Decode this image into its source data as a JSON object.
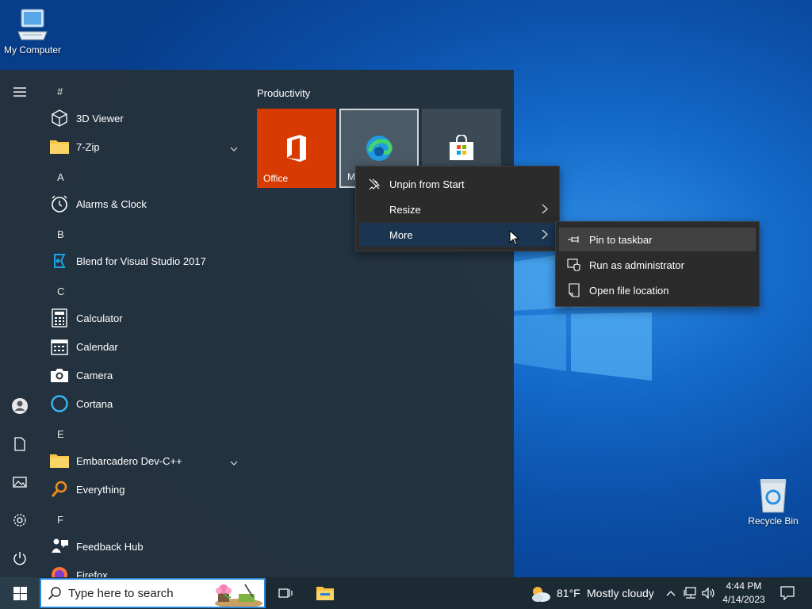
{
  "desktop": {
    "icons": [
      {
        "label": "My Computer",
        "icon": "computer-icon"
      },
      {
        "label": "Recycle Bin",
        "icon": "recycle-bin-icon"
      }
    ]
  },
  "start_menu": {
    "rail": [
      "hamburger-icon",
      "user-icon",
      "documents-icon",
      "pictures-icon",
      "settings-icon",
      "power-icon"
    ],
    "app_list": {
      "letters": [
        "#",
        "A",
        "B",
        "C",
        "E",
        "F"
      ],
      "apps": [
        {
          "label": "3D Viewer",
          "icon": "cube-icon"
        },
        {
          "label": "7-Zip",
          "icon": "folder-icon",
          "expandable": true
        },
        {
          "label": "Alarms & Clock",
          "icon": "clock-icon"
        },
        {
          "label": "Blend for Visual Studio 2017",
          "icon": "blend-icon"
        },
        {
          "label": "Calculator",
          "icon": "calculator-icon"
        },
        {
          "label": "Calendar",
          "icon": "calendar-icon"
        },
        {
          "label": "Camera",
          "icon": "camera-icon"
        },
        {
          "label": "Cortana",
          "icon": "cortana-icon"
        },
        {
          "label": "Embarcadero Dev-C++",
          "icon": "folder-icon",
          "expandable": true
        },
        {
          "label": "Everything",
          "icon": "search-magnifier-icon"
        },
        {
          "label": "Feedback Hub",
          "icon": "feedback-icon"
        },
        {
          "label": "Firefox",
          "icon": "firefox-icon"
        }
      ]
    },
    "tiles": {
      "group_title": "Productivity",
      "items": [
        {
          "label": "Office",
          "color": "#d83b01"
        },
        {
          "label": "M",
          "color": "#4a5a66"
        },
        {
          "label": "",
          "color": "#3c4a55"
        }
      ]
    }
  },
  "context_menu": {
    "items": [
      {
        "label": "Unpin from Start",
        "icon": "unpin-icon"
      },
      {
        "label": "Resize",
        "has_submenu": true
      },
      {
        "label": "More",
        "has_submenu": true,
        "active": true
      }
    ]
  },
  "submenu": {
    "items": [
      {
        "label": "Pin to taskbar",
        "icon": "pin-icon"
      },
      {
        "label": "Run as administrator",
        "icon": "shield-icon"
      },
      {
        "label": "Open file location",
        "icon": "file-location-icon"
      }
    ]
  },
  "taskbar": {
    "search_placeholder": "Type here to search",
    "weather": {
      "temp": "81°F",
      "condition": "Mostly cloudy"
    },
    "clock": {
      "time": "4:44 PM",
      "date": "4/14/2023"
    }
  },
  "colors": {
    "accent": "#0078d7",
    "office_tile": "#d83b01",
    "start_bg": "#24323c",
    "taskbar_bg": "#1c2a33"
  }
}
